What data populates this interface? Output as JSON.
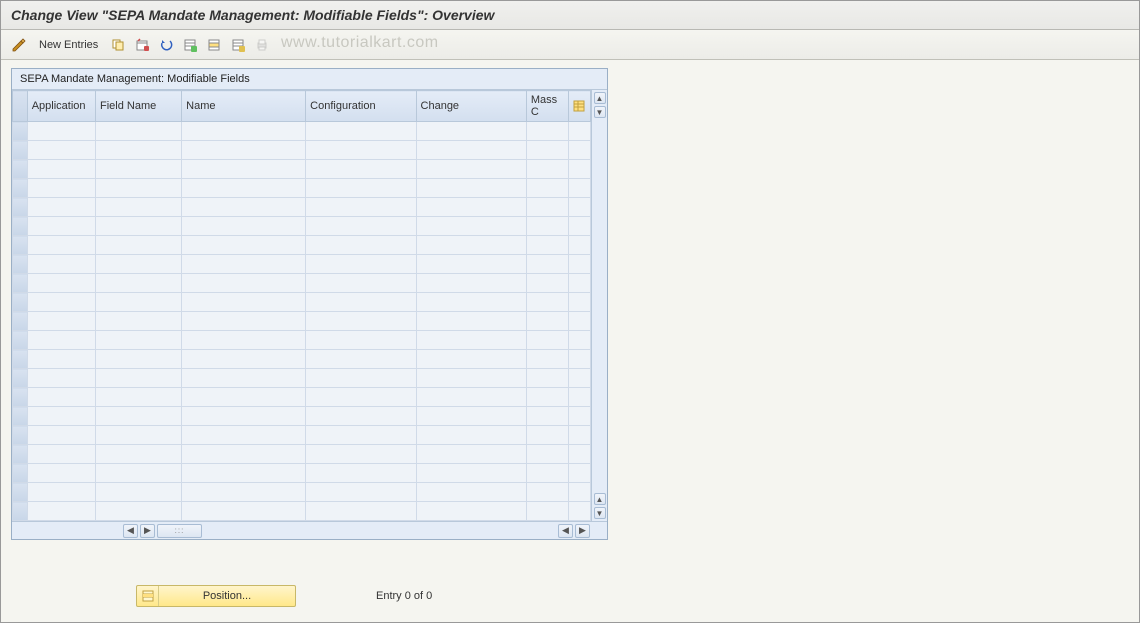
{
  "window": {
    "title": "Change View \"SEPA Mandate Management: Modifiable Fields\": Overview"
  },
  "toolbar": {
    "new_entries_label": "New Entries"
  },
  "watermark": "www.tutorialkart.com",
  "panel": {
    "title": "SEPA Mandate Management: Modifiable Fields"
  },
  "columns": {
    "application": "Application",
    "field_name": "Field Name",
    "name": "Name",
    "configuration": "Configuration",
    "change": "Change",
    "mass": "Mass C"
  },
  "footer": {
    "position_label": "Position...",
    "entry_text": "Entry 0 of 0"
  },
  "row_count": 21
}
